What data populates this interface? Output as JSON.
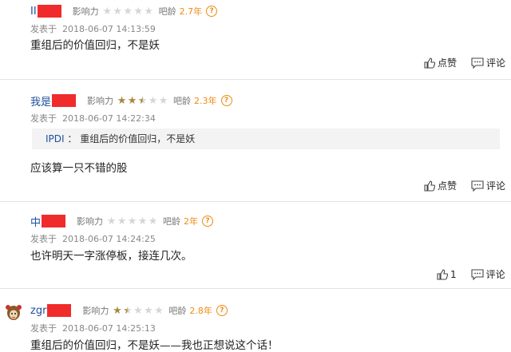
{
  "labels": {
    "influence": "影响力",
    "bar_age": "吧龄",
    "posted_at": "发表于",
    "like": "点赞",
    "comment": "评论",
    "help_icon": "?"
  },
  "comments": [
    {
      "username": "II",
      "stars": 0,
      "age": "2.7年",
      "time": "2018-06-07 14:13:59",
      "text": "重组后的价值回归，不是妖",
      "likes": ""
    },
    {
      "username": "我是",
      "stars": 2.5,
      "age": "2.3年",
      "time": "2018-06-07 14:22:34",
      "quote_name": "IPDI",
      "quote_sep": "：",
      "quote_text": "重组后的价值回归，不是妖",
      "text": "应该算一只不错的股",
      "likes": ""
    },
    {
      "username": "中",
      "stars": 0,
      "age": "2年",
      "time": "2018-06-07 14:24:25",
      "text": "也许明天一字涨停板，接连几次。",
      "likes": "1"
    },
    {
      "username": "zgr",
      "stars": 1.5,
      "age": "2.8年",
      "time": "2018-06-07 14:25:13",
      "text": "重组后的价值回归，不是妖——我也正想说这个话！",
      "likes": ""
    }
  ],
  "colors": {
    "username": "#1f4e9b",
    "age": "#ef8b12",
    "star_on": "#a9873f",
    "star_off": "#d6d6d6",
    "redaction": "#f02b2b"
  }
}
